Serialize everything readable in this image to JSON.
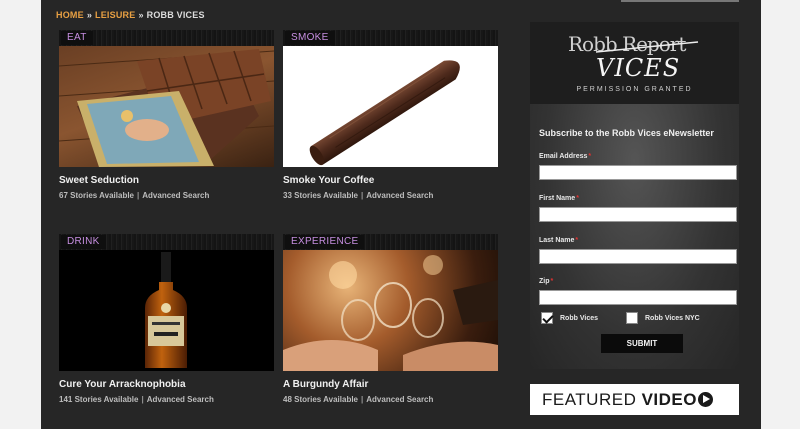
{
  "breadcrumb": {
    "home": "HOME",
    "sep1": "»",
    "leisure": "LEISURE",
    "sep2": "»",
    "current": "ROBB VICES"
  },
  "cards": [
    {
      "tag": "EAT",
      "title": "Sweet Seduction",
      "stories": "67 Stories Available",
      "search": "Advanced Search"
    },
    {
      "tag": "SMOKE",
      "title": "Smoke Your Coffee",
      "stories": "33 Stories Available",
      "search": "Advanced Search"
    },
    {
      "tag": "DRINK",
      "title": "Cure Your Arracknophobia",
      "stories": "141 Stories Available",
      "search": "Advanced Search"
    },
    {
      "tag": "EXPERIENCE",
      "title": "A Burgundy Affair",
      "stories": "48 Stories Available",
      "search": "Advanced Search"
    }
  ],
  "sidebar": {
    "logo_top": "Robb Report",
    "logo_main": "VICES",
    "logo_tagline": "PERMISSION GRANTED",
    "subscribe_title": "Subscribe to the Robb Vices eNewsletter",
    "fields": {
      "email": "Email Address",
      "first_name": "First Name",
      "last_name": "Last Name",
      "zip": "Zip"
    },
    "required_mark": "*",
    "checkboxes": [
      {
        "label": "Robb Vices",
        "checked": true
      },
      {
        "label": "Robb Vices NYC",
        "checked": false
      }
    ],
    "submit_label": "SUBMIT"
  },
  "featured": {
    "light": "FEATURED ",
    "bold": "VIDEO",
    "icon": "play-icon"
  },
  "colors": {
    "accent": "#e8a043",
    "tag": "#c68ee0",
    "required": "#e03232"
  }
}
